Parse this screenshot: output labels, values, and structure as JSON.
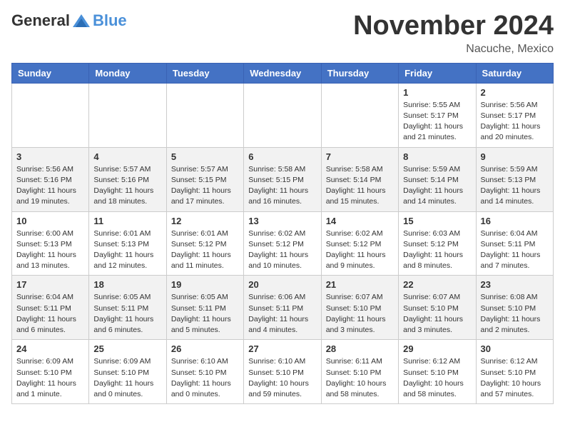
{
  "header": {
    "logo_general": "General",
    "logo_blue": "Blue",
    "month_title": "November 2024",
    "location": "Nacuche, Mexico"
  },
  "days_of_week": [
    "Sunday",
    "Monday",
    "Tuesday",
    "Wednesday",
    "Thursday",
    "Friday",
    "Saturday"
  ],
  "weeks": [
    [
      {
        "day": "",
        "info": ""
      },
      {
        "day": "",
        "info": ""
      },
      {
        "day": "",
        "info": ""
      },
      {
        "day": "",
        "info": ""
      },
      {
        "day": "",
        "info": ""
      },
      {
        "day": "1",
        "info": "Sunrise: 5:55 AM\nSunset: 5:17 PM\nDaylight: 11 hours\nand 21 minutes."
      },
      {
        "day": "2",
        "info": "Sunrise: 5:56 AM\nSunset: 5:17 PM\nDaylight: 11 hours\nand 20 minutes."
      }
    ],
    [
      {
        "day": "3",
        "info": "Sunrise: 5:56 AM\nSunset: 5:16 PM\nDaylight: 11 hours\nand 19 minutes."
      },
      {
        "day": "4",
        "info": "Sunrise: 5:57 AM\nSunset: 5:16 PM\nDaylight: 11 hours\nand 18 minutes."
      },
      {
        "day": "5",
        "info": "Sunrise: 5:57 AM\nSunset: 5:15 PM\nDaylight: 11 hours\nand 17 minutes."
      },
      {
        "day": "6",
        "info": "Sunrise: 5:58 AM\nSunset: 5:15 PM\nDaylight: 11 hours\nand 16 minutes."
      },
      {
        "day": "7",
        "info": "Sunrise: 5:58 AM\nSunset: 5:14 PM\nDaylight: 11 hours\nand 15 minutes."
      },
      {
        "day": "8",
        "info": "Sunrise: 5:59 AM\nSunset: 5:14 PM\nDaylight: 11 hours\nand 14 minutes."
      },
      {
        "day": "9",
        "info": "Sunrise: 5:59 AM\nSunset: 5:13 PM\nDaylight: 11 hours\nand 14 minutes."
      }
    ],
    [
      {
        "day": "10",
        "info": "Sunrise: 6:00 AM\nSunset: 5:13 PM\nDaylight: 11 hours\nand 13 minutes."
      },
      {
        "day": "11",
        "info": "Sunrise: 6:01 AM\nSunset: 5:13 PM\nDaylight: 11 hours\nand 12 minutes."
      },
      {
        "day": "12",
        "info": "Sunrise: 6:01 AM\nSunset: 5:12 PM\nDaylight: 11 hours\nand 11 minutes."
      },
      {
        "day": "13",
        "info": "Sunrise: 6:02 AM\nSunset: 5:12 PM\nDaylight: 11 hours\nand 10 minutes."
      },
      {
        "day": "14",
        "info": "Sunrise: 6:02 AM\nSunset: 5:12 PM\nDaylight: 11 hours\nand 9 minutes."
      },
      {
        "day": "15",
        "info": "Sunrise: 6:03 AM\nSunset: 5:12 PM\nDaylight: 11 hours\nand 8 minutes."
      },
      {
        "day": "16",
        "info": "Sunrise: 6:04 AM\nSunset: 5:11 PM\nDaylight: 11 hours\nand 7 minutes."
      }
    ],
    [
      {
        "day": "17",
        "info": "Sunrise: 6:04 AM\nSunset: 5:11 PM\nDaylight: 11 hours\nand 6 minutes."
      },
      {
        "day": "18",
        "info": "Sunrise: 6:05 AM\nSunset: 5:11 PM\nDaylight: 11 hours\nand 6 minutes."
      },
      {
        "day": "19",
        "info": "Sunrise: 6:05 AM\nSunset: 5:11 PM\nDaylight: 11 hours\nand 5 minutes."
      },
      {
        "day": "20",
        "info": "Sunrise: 6:06 AM\nSunset: 5:11 PM\nDaylight: 11 hours\nand 4 minutes."
      },
      {
        "day": "21",
        "info": "Sunrise: 6:07 AM\nSunset: 5:10 PM\nDaylight: 11 hours\nand 3 minutes."
      },
      {
        "day": "22",
        "info": "Sunrise: 6:07 AM\nSunset: 5:10 PM\nDaylight: 11 hours\nand 3 minutes."
      },
      {
        "day": "23",
        "info": "Sunrise: 6:08 AM\nSunset: 5:10 PM\nDaylight: 11 hours\nand 2 minutes."
      }
    ],
    [
      {
        "day": "24",
        "info": "Sunrise: 6:09 AM\nSunset: 5:10 PM\nDaylight: 11 hours\nand 1 minute."
      },
      {
        "day": "25",
        "info": "Sunrise: 6:09 AM\nSunset: 5:10 PM\nDaylight: 11 hours\nand 0 minutes."
      },
      {
        "day": "26",
        "info": "Sunrise: 6:10 AM\nSunset: 5:10 PM\nDaylight: 11 hours\nand 0 minutes."
      },
      {
        "day": "27",
        "info": "Sunrise: 6:10 AM\nSunset: 5:10 PM\nDaylight: 10 hours\nand 59 minutes."
      },
      {
        "day": "28",
        "info": "Sunrise: 6:11 AM\nSunset: 5:10 PM\nDaylight: 10 hours\nand 58 minutes."
      },
      {
        "day": "29",
        "info": "Sunrise: 6:12 AM\nSunset: 5:10 PM\nDaylight: 10 hours\nand 58 minutes."
      },
      {
        "day": "30",
        "info": "Sunrise: 6:12 AM\nSunset: 5:10 PM\nDaylight: 10 hours\nand 57 minutes."
      }
    ]
  ]
}
